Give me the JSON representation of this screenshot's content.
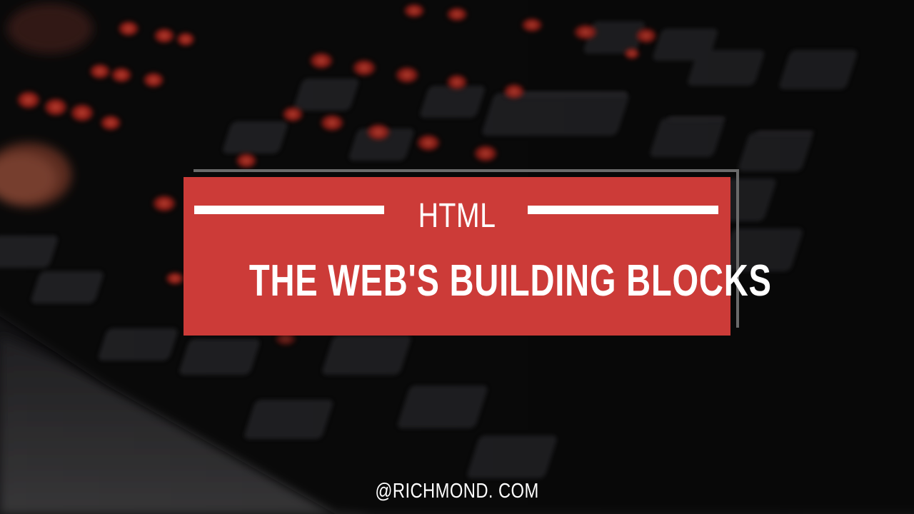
{
  "card": {
    "subtitle": "HTML",
    "headline": "THE WEB'S BUILDING BLOCKS"
  },
  "footer": {
    "handle": "@RICHMOND. COM"
  },
  "colors": {
    "card_red": "#cc3b38",
    "text": "#ffffff",
    "key_glow": "#ff3b2a",
    "background": "#141316"
  },
  "background_image": {
    "icon": "backlit-keyboard-photo"
  }
}
